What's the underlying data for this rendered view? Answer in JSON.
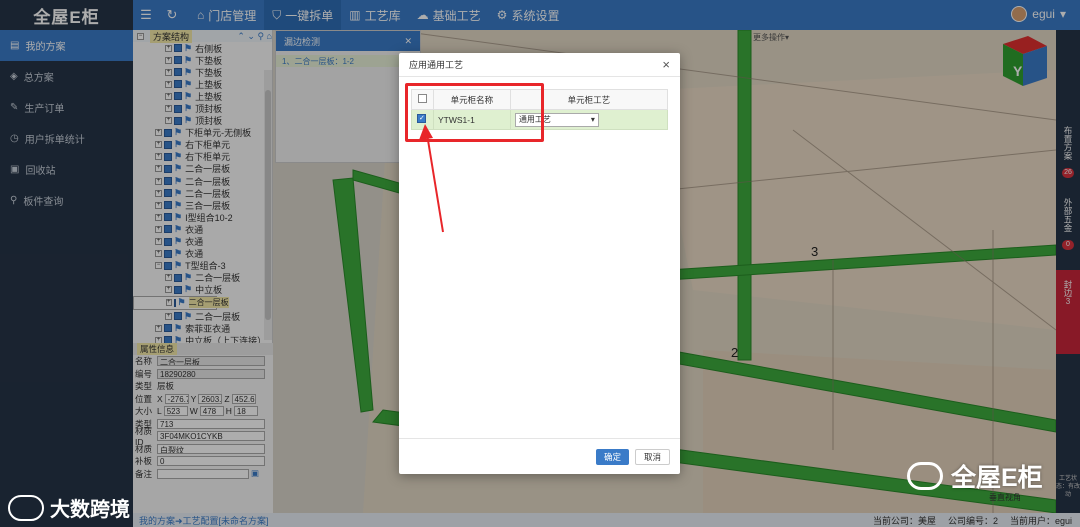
{
  "app": {
    "logo": "全屋E柜"
  },
  "topnav": {
    "items": [
      {
        "label": "门店管理"
      },
      {
        "label": "一键拆单"
      },
      {
        "label": "工艺库"
      },
      {
        "label": "基础工艺"
      },
      {
        "label": "系统设置"
      }
    ],
    "user": "egui"
  },
  "sidebar": {
    "items": [
      {
        "label": "我的方案"
      },
      {
        "label": "总方案"
      },
      {
        "label": "生产订单"
      },
      {
        "label": "用户拆单统计"
      },
      {
        "label": "回收站"
      },
      {
        "label": "板件查询"
      }
    ]
  },
  "tree": {
    "title": "方案结构",
    "nodes": [
      {
        "label": "右侧板"
      },
      {
        "label": "下垫板"
      },
      {
        "label": "下垫板"
      },
      {
        "label": "上垫板"
      },
      {
        "label": "上垫板"
      },
      {
        "label": "顶封板"
      },
      {
        "label": "顶封板"
      },
      {
        "label": "下柜单元-无侧板"
      },
      {
        "label": "右下柜单元"
      },
      {
        "label": "右下柜单元"
      },
      {
        "label": "二合一层板"
      },
      {
        "label": "二合一层板"
      },
      {
        "label": "二合一层板"
      },
      {
        "label": "三合一层板"
      },
      {
        "label": "I型组合10-2"
      },
      {
        "label": "衣通"
      },
      {
        "label": "衣通"
      },
      {
        "label": "衣通"
      },
      {
        "label": "T型组合-3"
      },
      {
        "label": "二合一层板"
      },
      {
        "label": "中立板"
      },
      {
        "label": "二合一层板"
      },
      {
        "label": "二合一层板"
      },
      {
        "label": "索菲亚衣通"
      },
      {
        "label": "中立板（上下连接）"
      }
    ]
  },
  "props": {
    "title": "属性信息",
    "name_label": "名称",
    "name": "二合一层板",
    "code_label": "编号",
    "code": "18290280",
    "type_label": "类型",
    "type": "层板",
    "pos_label": "位置",
    "x": "-276.7",
    "y": "2603.4",
    "z": "452.6",
    "size_label": "大小",
    "l": "523",
    "w": "478",
    "h": "18",
    "kind_label": "类型",
    "kind": "713",
    "mat_label": "材质ID",
    "mat": "3F04MKO1CYKB",
    "matname_label": "材质",
    "matname": "白裂纹",
    "pad_label": "补板",
    "pad": "0",
    "note_label": "备注",
    "note": ""
  },
  "loupe": {
    "title": "漏边检测",
    "row": "1、二合一层板：1-2"
  },
  "canvas": {
    "more": "更多操作",
    "label_2": "2",
    "label_3": "3",
    "cube_letter": "Y",
    "view": "垂直视角"
  },
  "rightpanel": {
    "items": [
      {
        "label": "布置方案",
        "badge": "26"
      },
      {
        "label": "外部五金",
        "badge": "0"
      },
      {
        "label": "封边",
        "badge": "3"
      }
    ],
    "extra": "工艺状态：有改动"
  },
  "modal": {
    "title": "应用通用工艺",
    "col_name": "单元柜名称",
    "col_craft": "单元柜工艺",
    "row_name": "YTWS1-1",
    "row_craft": "通用工艺",
    "ok": "确定",
    "cancel": "取消"
  },
  "bottombar": {
    "path": "我的方案➜工艺配置[未命名方案]",
    "store": "当前公司：美屋",
    "company": "公司编号：2",
    "user": "当前用户：egui"
  },
  "watermark": {
    "brand": "全屋E柜",
    "brand2": "大数跨境"
  },
  "colors": {
    "topbar": "#3a7bc8",
    "sidebar": "#263447",
    "highlight": "#e8262a",
    "panel_green": "#3daa3d"
  }
}
